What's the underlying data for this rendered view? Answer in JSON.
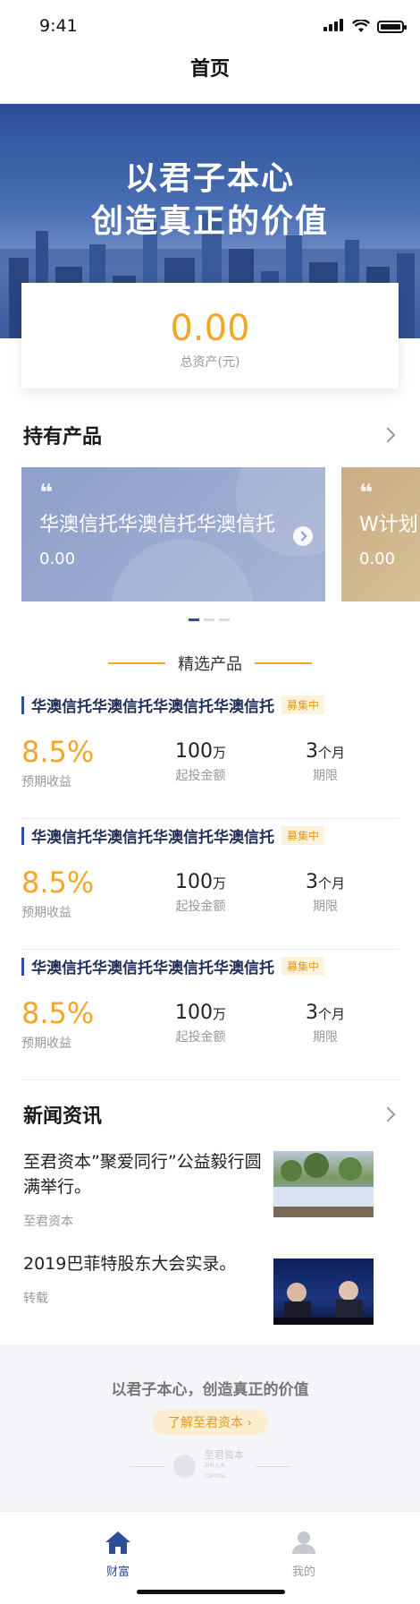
{
  "status_bar": {
    "time": "9:41"
  },
  "nav": {
    "title": "首页"
  },
  "banner": {
    "line1": "以君子本心",
    "line2": "创造真正的价值"
  },
  "asset": {
    "value": "0.00",
    "label": "总资产(元)"
  },
  "holdings": {
    "title": "持有产品",
    "items": [
      {
        "name": "华澳信托华澳信托华澳信托",
        "value": "0.00"
      },
      {
        "name": "W计划",
        "value": "0.00"
      }
    ]
  },
  "featured": {
    "title": "精选产品",
    "products": [
      {
        "name": "华澳信托华澳信托华澳信托华澳信托",
        "badge": "募集中",
        "rate": "8.5%",
        "rate_label": "预期收益",
        "amount": "100",
        "amount_unit": "万",
        "amount_label": "起投金额",
        "term": "3",
        "term_unit": "个月",
        "term_label": "期限"
      },
      {
        "name": "华澳信托华澳信托华澳信托华澳信托",
        "badge": "募集中",
        "rate": "8.5%",
        "rate_label": "预期收益",
        "amount": "100",
        "amount_unit": "万",
        "amount_label": "起投金额",
        "term": "3",
        "term_unit": "个月",
        "term_label": "期限"
      },
      {
        "name": "华澳信托华澳信托华澳信托华澳信托",
        "badge": "募集中",
        "rate": "8.5%",
        "rate_label": "预期收益",
        "amount": "100",
        "amount_unit": "万",
        "amount_label": "起投金额",
        "term": "3",
        "term_unit": "个月",
        "term_label": "期限"
      }
    ]
  },
  "news": {
    "title": "新闻资讯",
    "items": [
      {
        "title": "至君资本”聚爱同行”公益毅行圆满举行。",
        "source": "至君资本"
      },
      {
        "title": "2019巴菲特股东大会实录。",
        "source": "转载"
      }
    ]
  },
  "footer": {
    "slogan": "以君子本心，创造真正的价值",
    "link": "了解至君资本 ›",
    "logo_text": "至君资本",
    "logo_sub": "ZHI JUN CAPITAL"
  },
  "tabs": [
    {
      "label": "财富",
      "icon": "home-icon",
      "active": true
    },
    {
      "label": "我的",
      "icon": "user-icon",
      "active": false
    }
  ],
  "colors": {
    "primary": "#2c4f97",
    "accent": "#f5a623",
    "badge_bg": "#fdf3dc"
  }
}
